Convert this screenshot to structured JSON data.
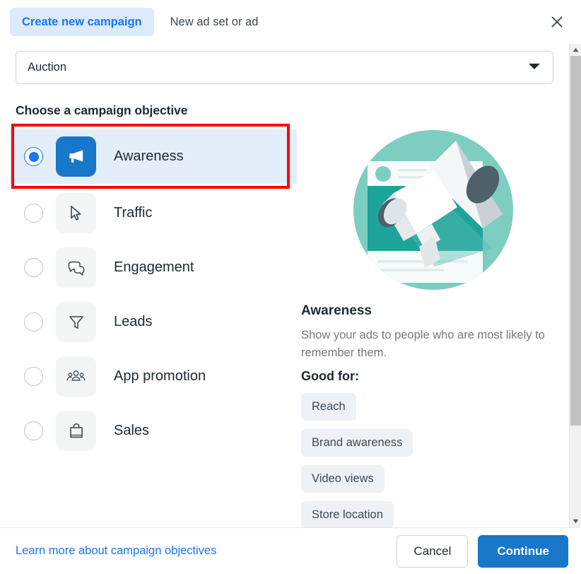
{
  "header": {
    "tab_active": "Create new campaign",
    "tab_inactive": "New ad set or ad",
    "close_icon": "close-icon"
  },
  "buying_type": {
    "value": "Auction",
    "caret_icon": "chevron-down-icon"
  },
  "objectives_section": {
    "title": "Choose a campaign objective",
    "items": [
      {
        "label": "Awareness",
        "icon": "megaphone-icon",
        "selected": true
      },
      {
        "label": "Traffic",
        "icon": "cursor-icon",
        "selected": false
      },
      {
        "label": "Engagement",
        "icon": "chat-bubbles-icon",
        "selected": false
      },
      {
        "label": "Leads",
        "icon": "funnel-icon",
        "selected": false
      },
      {
        "label": "App promotion",
        "icon": "people-group-icon",
        "selected": false
      },
      {
        "label": "Sales",
        "icon": "shopping-bag-icon",
        "selected": false
      }
    ]
  },
  "preview": {
    "illustration": "megaphone-illustration",
    "title": "Awareness",
    "description": "Show your ads to people who are most likely to remember them.",
    "good_for_label": "Good for:",
    "chips": [
      "Reach",
      "Brand awareness",
      "Video views",
      "Store location"
    ]
  },
  "footer": {
    "learn_more": "Learn more about campaign objectives",
    "cancel": "Cancel",
    "continue": "Continue"
  },
  "colors": {
    "accent_blue": "#1877f2",
    "button_blue": "#1877c9",
    "selected_row_bg": "#e3eefa",
    "highlight_red": "#ff0000",
    "illustration_teal": "#77cbbf",
    "illustration_teal_dark": "#1ea39b"
  },
  "scrollbar": {
    "up_arrow_icon": "triangle-up-icon",
    "down_arrow_icon": "triangle-down-icon"
  }
}
